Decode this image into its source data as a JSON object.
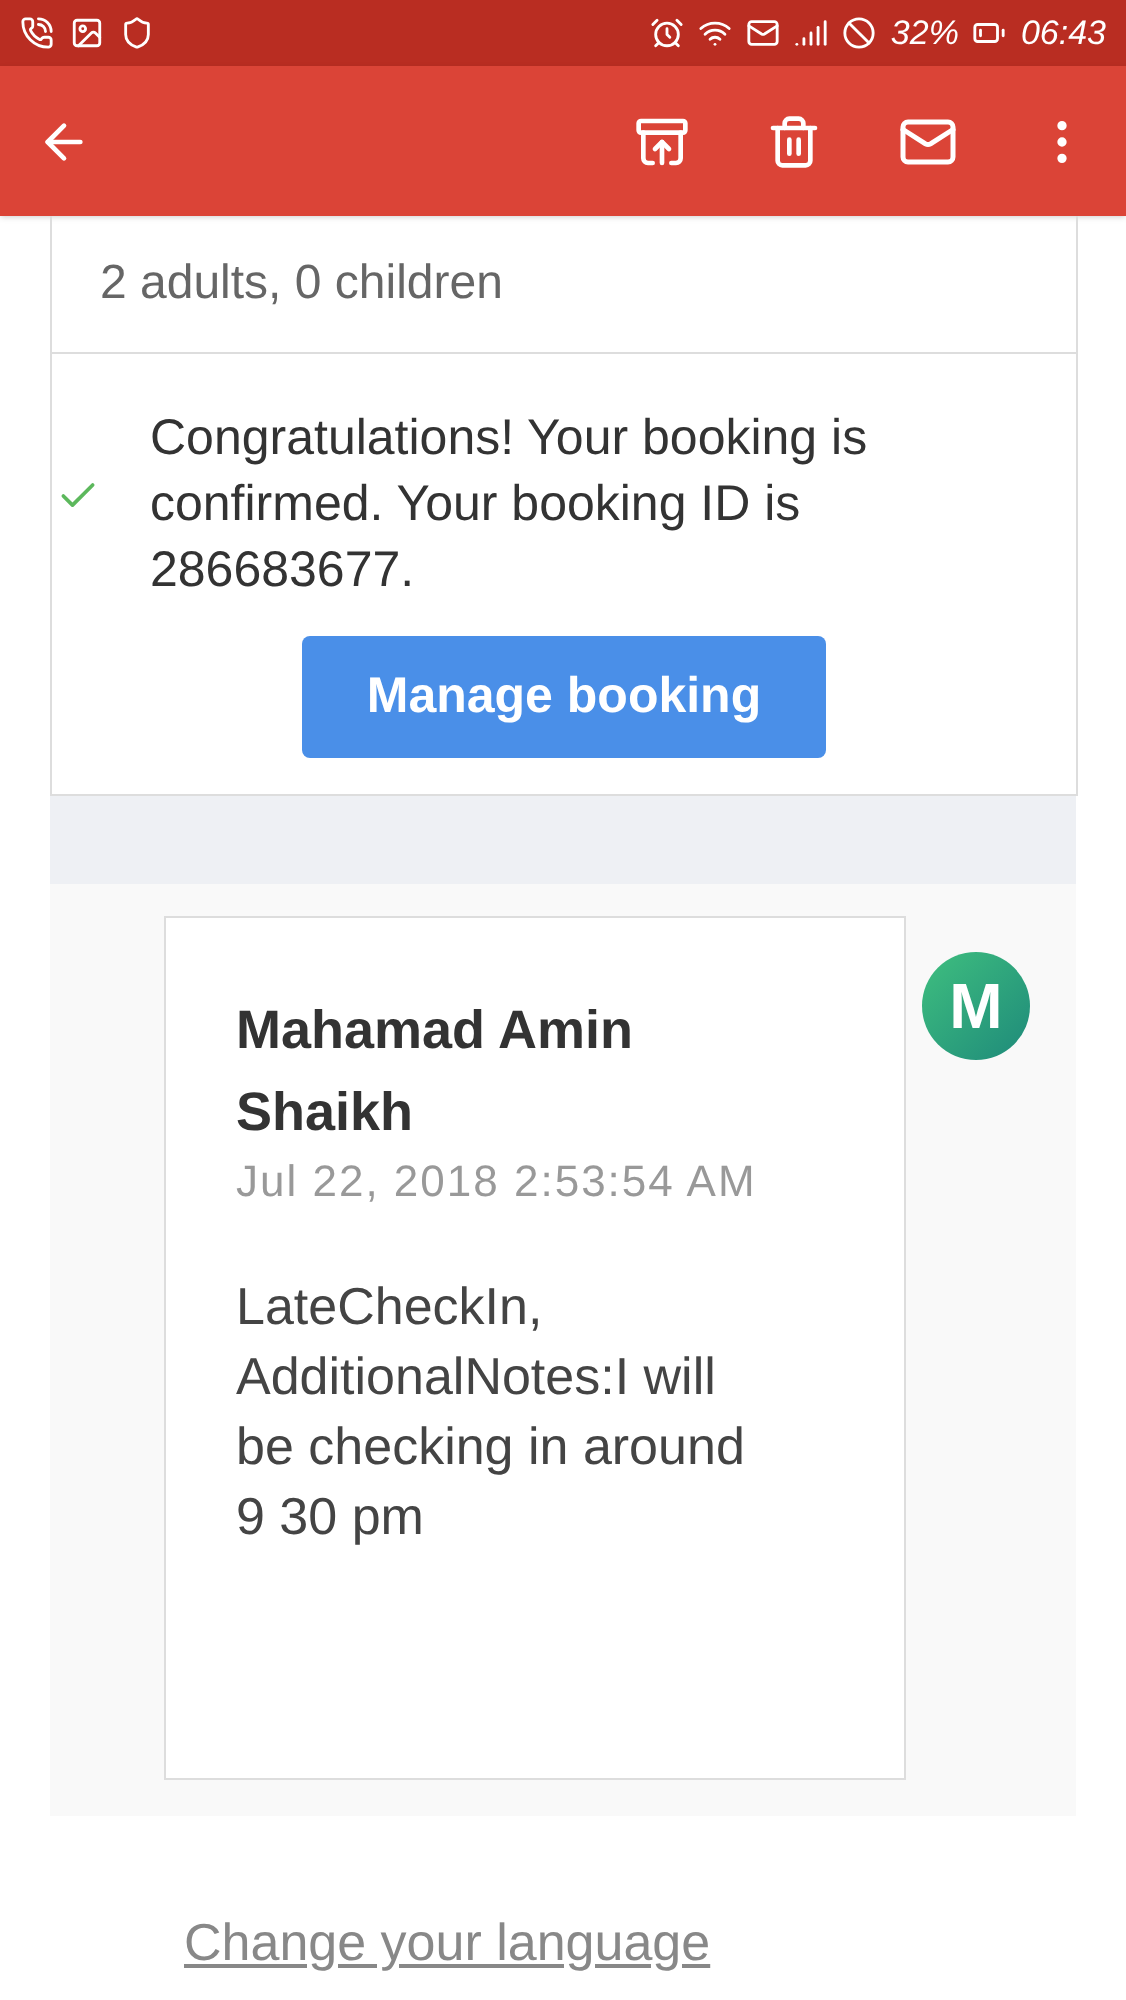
{
  "status_bar": {
    "battery": "32%",
    "time": "06:43"
  },
  "booking": {
    "guests": "2 adults, 0 children",
    "confirmed": true,
    "message": "Congratulations! Your booking is confirmed. Your booking ID is 286683677.",
    "button": "Manage booking"
  },
  "reply": {
    "avatar": "M",
    "sender": "Mahamad Amin Shaikh",
    "date": "Jul 22, 2018 2:53:54 AM",
    "body": "LateCheckIn, AdditionalNotes:I will be checking in around 9 30 pm"
  },
  "footer_link": "Change your language"
}
